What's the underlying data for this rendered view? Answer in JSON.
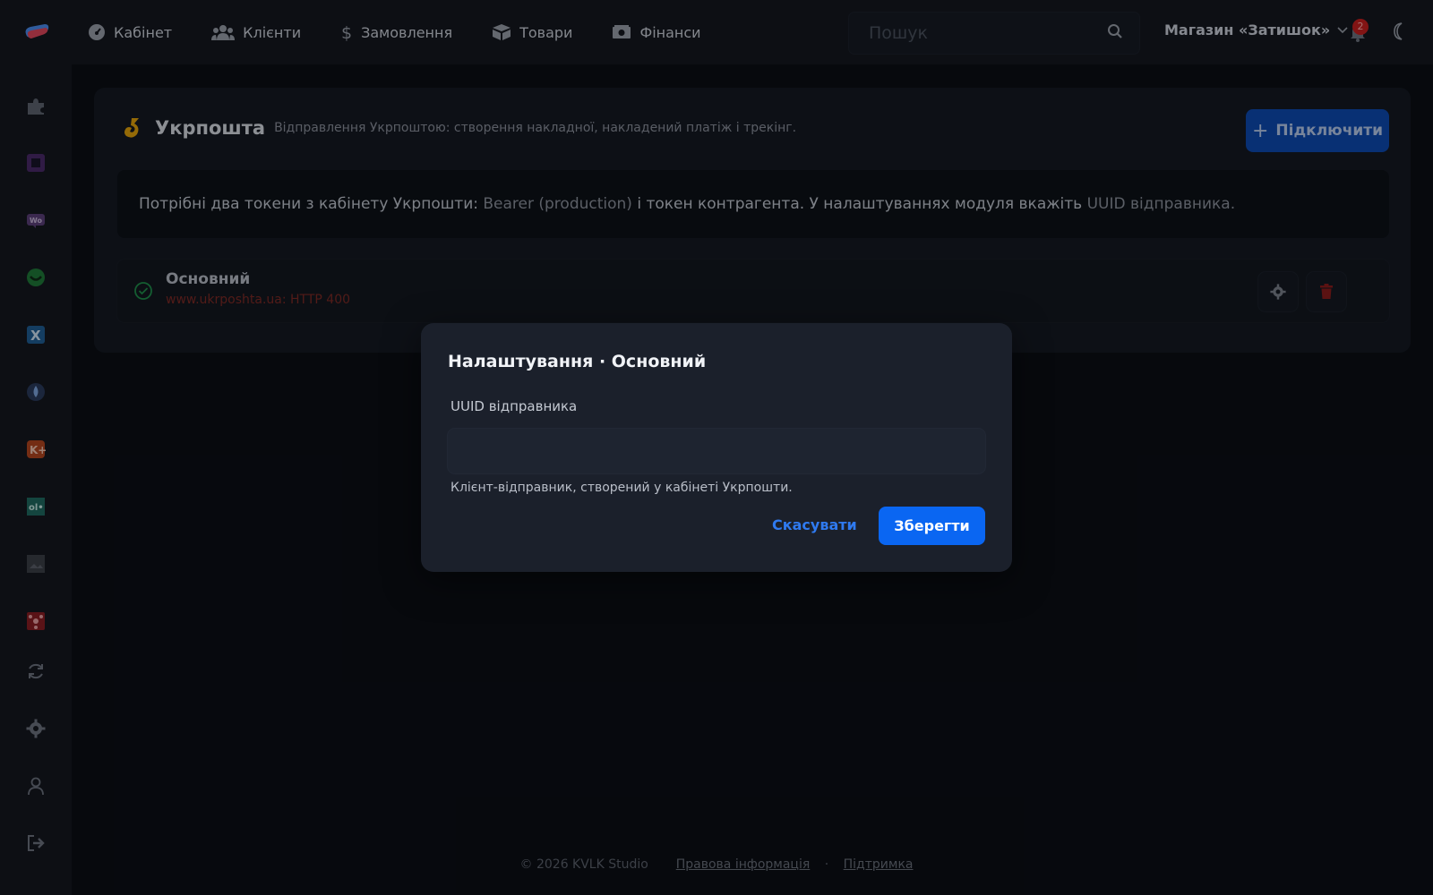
{
  "nav": {
    "items": [
      {
        "label": "Кабінет",
        "icon": "gauge-icon"
      },
      {
        "label": "Клієнти",
        "icon": "users-icon"
      },
      {
        "label": "Замовлення",
        "icon": "dollar-icon"
      },
      {
        "label": "Товари",
        "icon": "box-icon"
      },
      {
        "label": "Фінанси",
        "icon": "money-icon"
      }
    ],
    "search_placeholder": "Пошук",
    "store_name": "Магазин «Затишок»",
    "notifications_count": "2"
  },
  "sidebar": {
    "items": [
      "puzzle-icon",
      "square-app-icon",
      "woo-icon",
      "smile-app-icon",
      "x-app-icon",
      "drop-app-icon",
      "k-app-icon",
      "ol-app-icon",
      "image-app-icon",
      "nodes-app-icon",
      "sync-icon",
      "settings-icon",
      "user-icon",
      "logout-icon"
    ]
  },
  "card": {
    "title": "Укрпошта",
    "description": "Відправлення Укрпоштою: створення накладної, накладений платіж і трекінг.",
    "connect_label": "Підключити",
    "info": {
      "part1": "Потрібні два токени з кабінету Укрпошти: ",
      "part2": "Bearer (production)",
      "part3": " і токен контрагента. У налаштуваннях модуля вкажіть ",
      "part4": "UUID відправника",
      "part5": "."
    },
    "row": {
      "name": "Основний",
      "status": "www.ukrposhta.ua: HTTP 400"
    }
  },
  "footer": {
    "copyright": "© 2026 KVLK Studio",
    "legal": "Правова інформація",
    "separator": "·",
    "support": "Підтримка"
  },
  "modal": {
    "title": "Налаштування · Основний",
    "field_label": "UUID відправника",
    "field_value": "",
    "hint": "Клієнт-відправник, створений у кабінеті Укрпошти.",
    "cancel_label": "Скасувати",
    "save_label": "Зберегти"
  },
  "colors": {
    "accent": "#0a66f2",
    "success": "#1f9d55",
    "danger": "#c81f1f",
    "brand_yellow": "#f2b705"
  }
}
